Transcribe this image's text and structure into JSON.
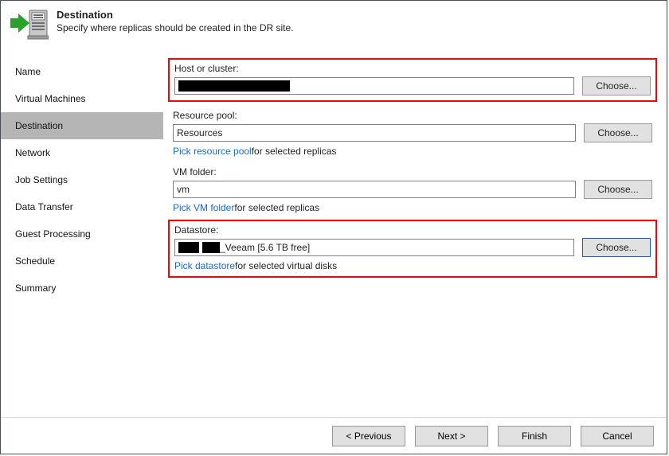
{
  "header": {
    "title": "Destination",
    "description": "Specify where replicas should be created in the DR site."
  },
  "sidebar": {
    "items": [
      {
        "label": "Name"
      },
      {
        "label": "Virtual Machines"
      },
      {
        "label": "Destination"
      },
      {
        "label": "Network"
      },
      {
        "label": "Job Settings"
      },
      {
        "label": "Data Transfer"
      },
      {
        "label": "Guest Processing"
      },
      {
        "label": "Schedule"
      },
      {
        "label": "Summary"
      }
    ],
    "selected_index": 2
  },
  "fields": {
    "host": {
      "label": "Host or cluster:",
      "value": "████████████",
      "choose": "Choose..."
    },
    "pool": {
      "label": "Resource pool:",
      "value": "Resources",
      "choose": "Choose...",
      "picklink": "Pick resource pool",
      "picksuffix": "  for selected replicas"
    },
    "folder": {
      "label": "VM folder:",
      "value": "vm",
      "choose": "Choose...",
      "picklink": "Pick VM folder",
      "picksuffix": "  for selected replicas"
    },
    "datastore": {
      "label": "Datastore:",
      "value_prefix": "███_███",
      "value_suffix": "_Veeam [5.6 TB free]",
      "choose": "Choose...",
      "picklink": "Pick datastore",
      "picksuffix": "  for selected virtual disks"
    }
  },
  "footer": {
    "previous": "< Previous",
    "next": "Next >",
    "finish": "Finish",
    "cancel": "Cancel"
  }
}
